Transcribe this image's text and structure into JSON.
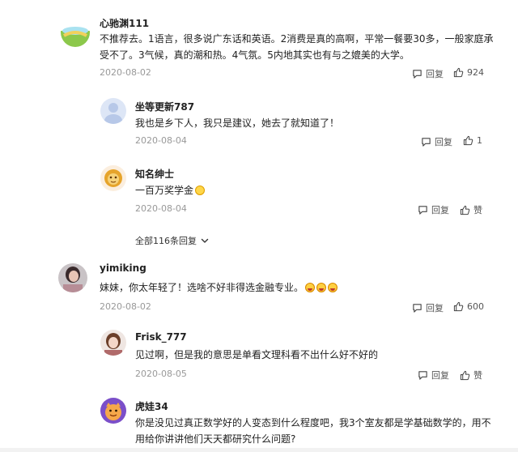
{
  "comments": [
    {
      "user": "心驰渊111",
      "text": "不推荐去。1语言，很多说广东话和英语。2消费是真的高啊，平常一餐要30多，一般家庭承受不了。3气候，真的潮和热。4气氛。5内地其实也有与之媲美的大学。",
      "date": "2020-08-02",
      "reply_label": "回复",
      "likes": "924",
      "replies": [
        {
          "user": "坐等更新787",
          "text": "我也是乡下人，我只是建议，她去了就知道了！",
          "date": "2020-08-04",
          "reply_label": "回复",
          "likes": "1"
        },
        {
          "user": "知名绅士",
          "text": "一百万奖学金",
          "date": "2020-08-04",
          "reply_label": "回复",
          "likes": "赞"
        }
      ],
      "more_replies": "全部116条回复"
    },
    {
      "user": "yimiking",
      "text": "妹妹，你太年轻了！选啥不好非得选金融专业。",
      "date": "2020-08-02",
      "reply_label": "回复",
      "likes": "600",
      "replies": [
        {
          "user": "Frisk_777",
          "text": "见过啊，但是我的意思是单看文理科看不出什么好不好的",
          "date": "2020-08-05",
          "reply_label": "回复",
          "likes": "赞"
        },
        {
          "user": "虎娃34",
          "text": "你是没见过真正数学好的人变态到什么程度吧，我3个室友都是学基础数学的，用不用给你讲讲他们天天都研究什么问题?"
        }
      ]
    }
  ],
  "icons": {
    "reply": "comment-bubble-icon",
    "like": "thumbs-up-icon",
    "expand": "chevron-down-icon",
    "emoji": "emoji-icon"
  }
}
